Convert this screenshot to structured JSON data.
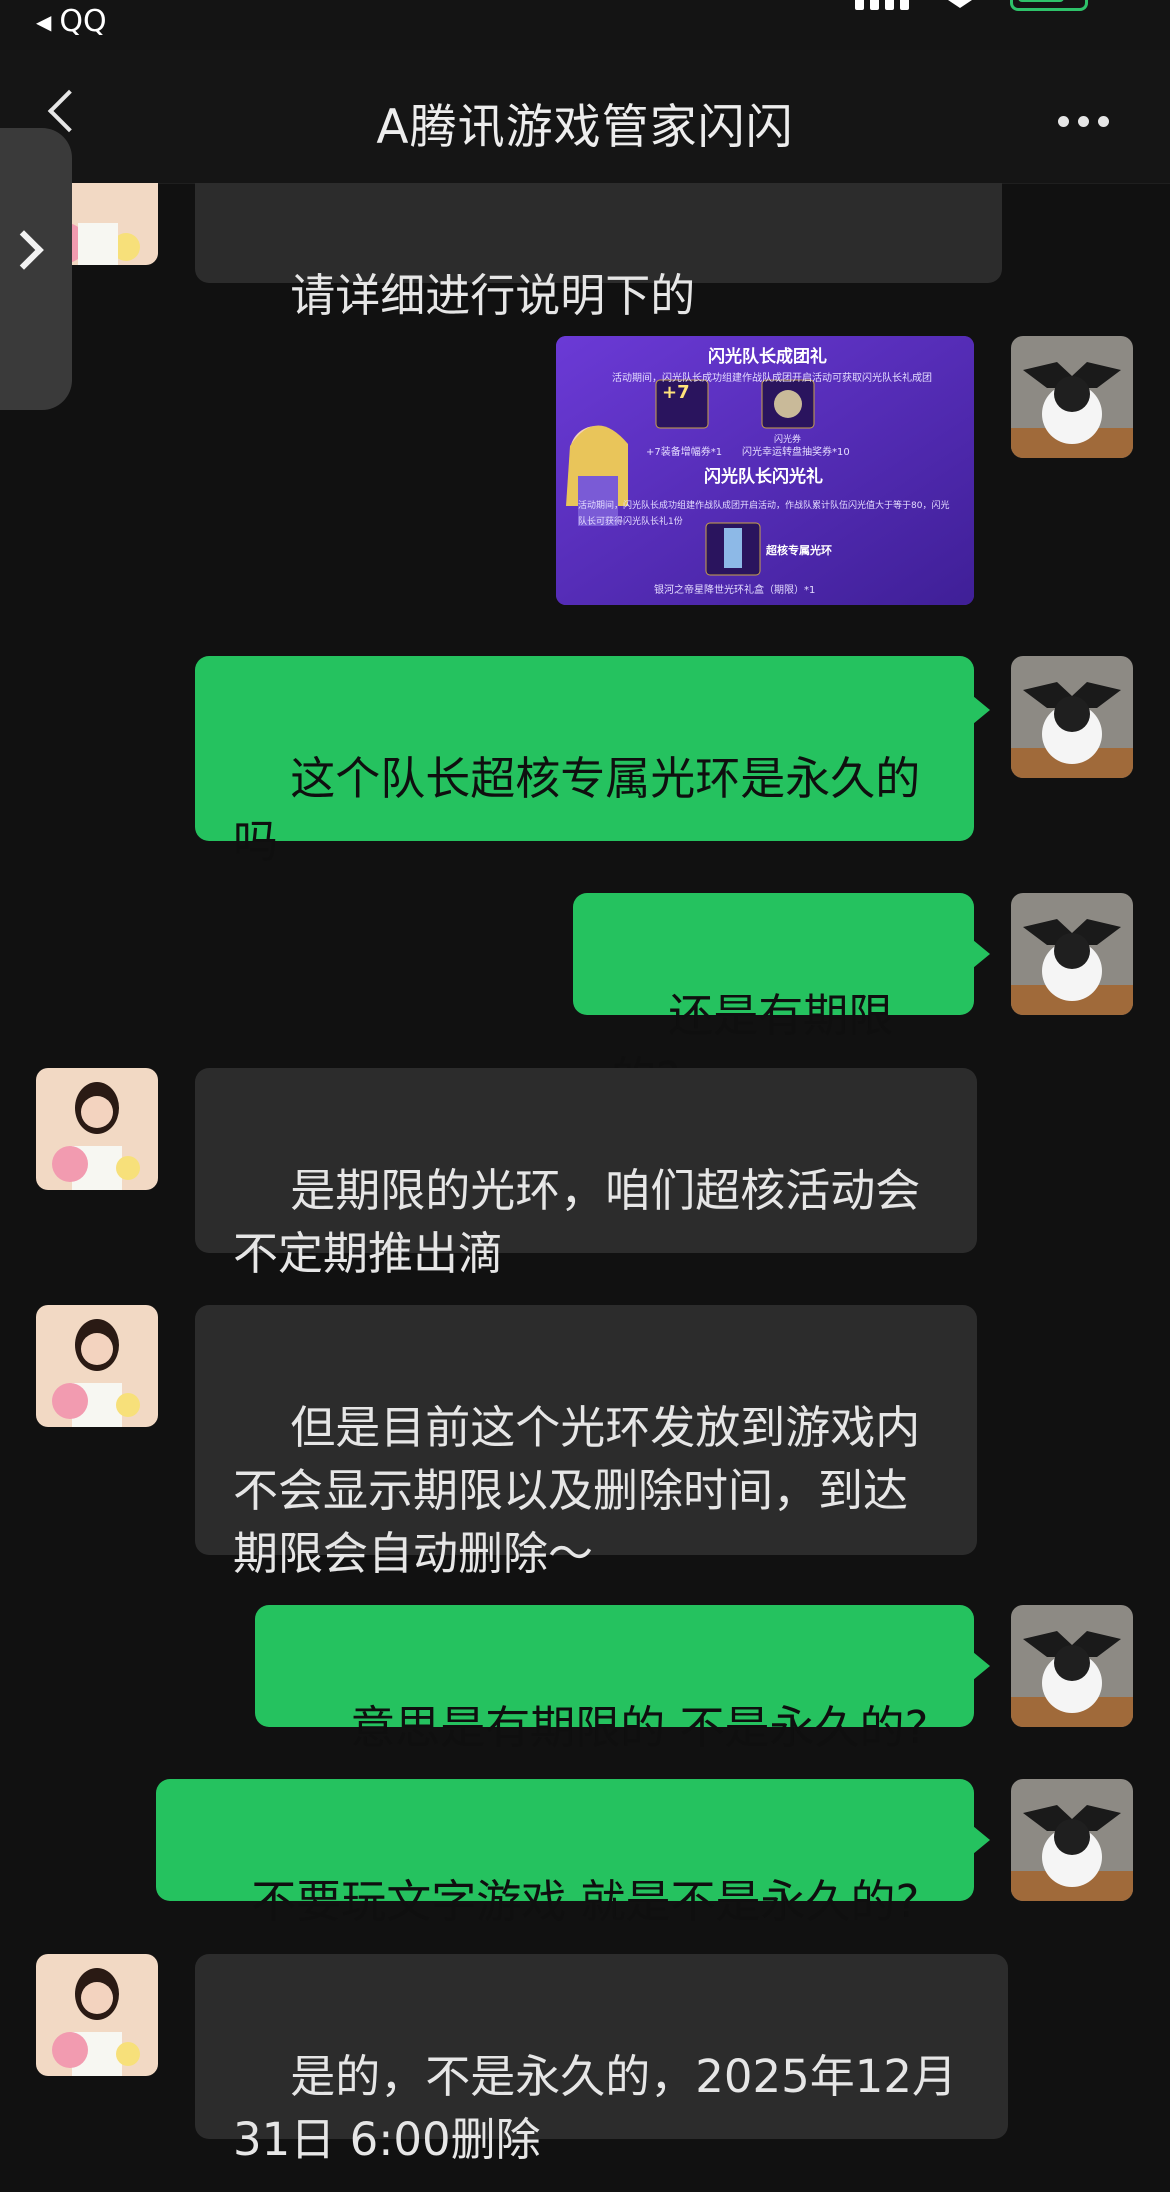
{
  "status_bar": {
    "back_app_label": "QQ"
  },
  "header": {
    "title": "A腾讯游戏管家闪闪"
  },
  "promo_image": {
    "title1": "闪光队长成团礼",
    "desc1": "活动期间，闪光队长成功组建作战队成团开启活动可获取闪光队长礼成团礼1份",
    "item1_label": "+7装备增幅券*1",
    "item1_badge": "+7",
    "item2_label": "闪光幸运转盘抽奖券*10",
    "item2_tag": "闪光券",
    "title2": "闪光队长闪光礼",
    "desc2": "活动期间，闪光队长成功组建作战队成团开启活动，作战队累计队伍闪光值大于等于80，闪光队长可获得闪光队长礼1份",
    "item3_tag": "超核专属光环",
    "item3_label": "银河之帝星降世光环礼盒（期限）*1"
  },
  "messages": [
    {
      "side": "in",
      "text": "请详细进行说明下的"
    },
    {
      "side": "out",
      "type": "image"
    },
    {
      "side": "out",
      "text": "这个队长超核专属光环是永久的吗"
    },
    {
      "side": "out",
      "text": "还是有期限的?"
    },
    {
      "side": "in",
      "text": "是期限的光环，咱们超核活动会不定期推出滴"
    },
    {
      "side": "in",
      "text": "但是目前这个光环发放到游戏内不会显示期限以及删除时间，到达期限会自动删除～"
    },
    {
      "side": "out",
      "text": "意思是有期限的 不是永久的?"
    },
    {
      "side": "out",
      "text": "不要玩文字游戏 就是不是永久的?"
    },
    {
      "side": "in",
      "text": "是的，不是永久的，2025年12月31日 6:00删除"
    }
  ],
  "colors": {
    "background": "#111111",
    "incoming_bubble": "#2c2c2c",
    "outgoing_bubble": "#25c25f"
  }
}
